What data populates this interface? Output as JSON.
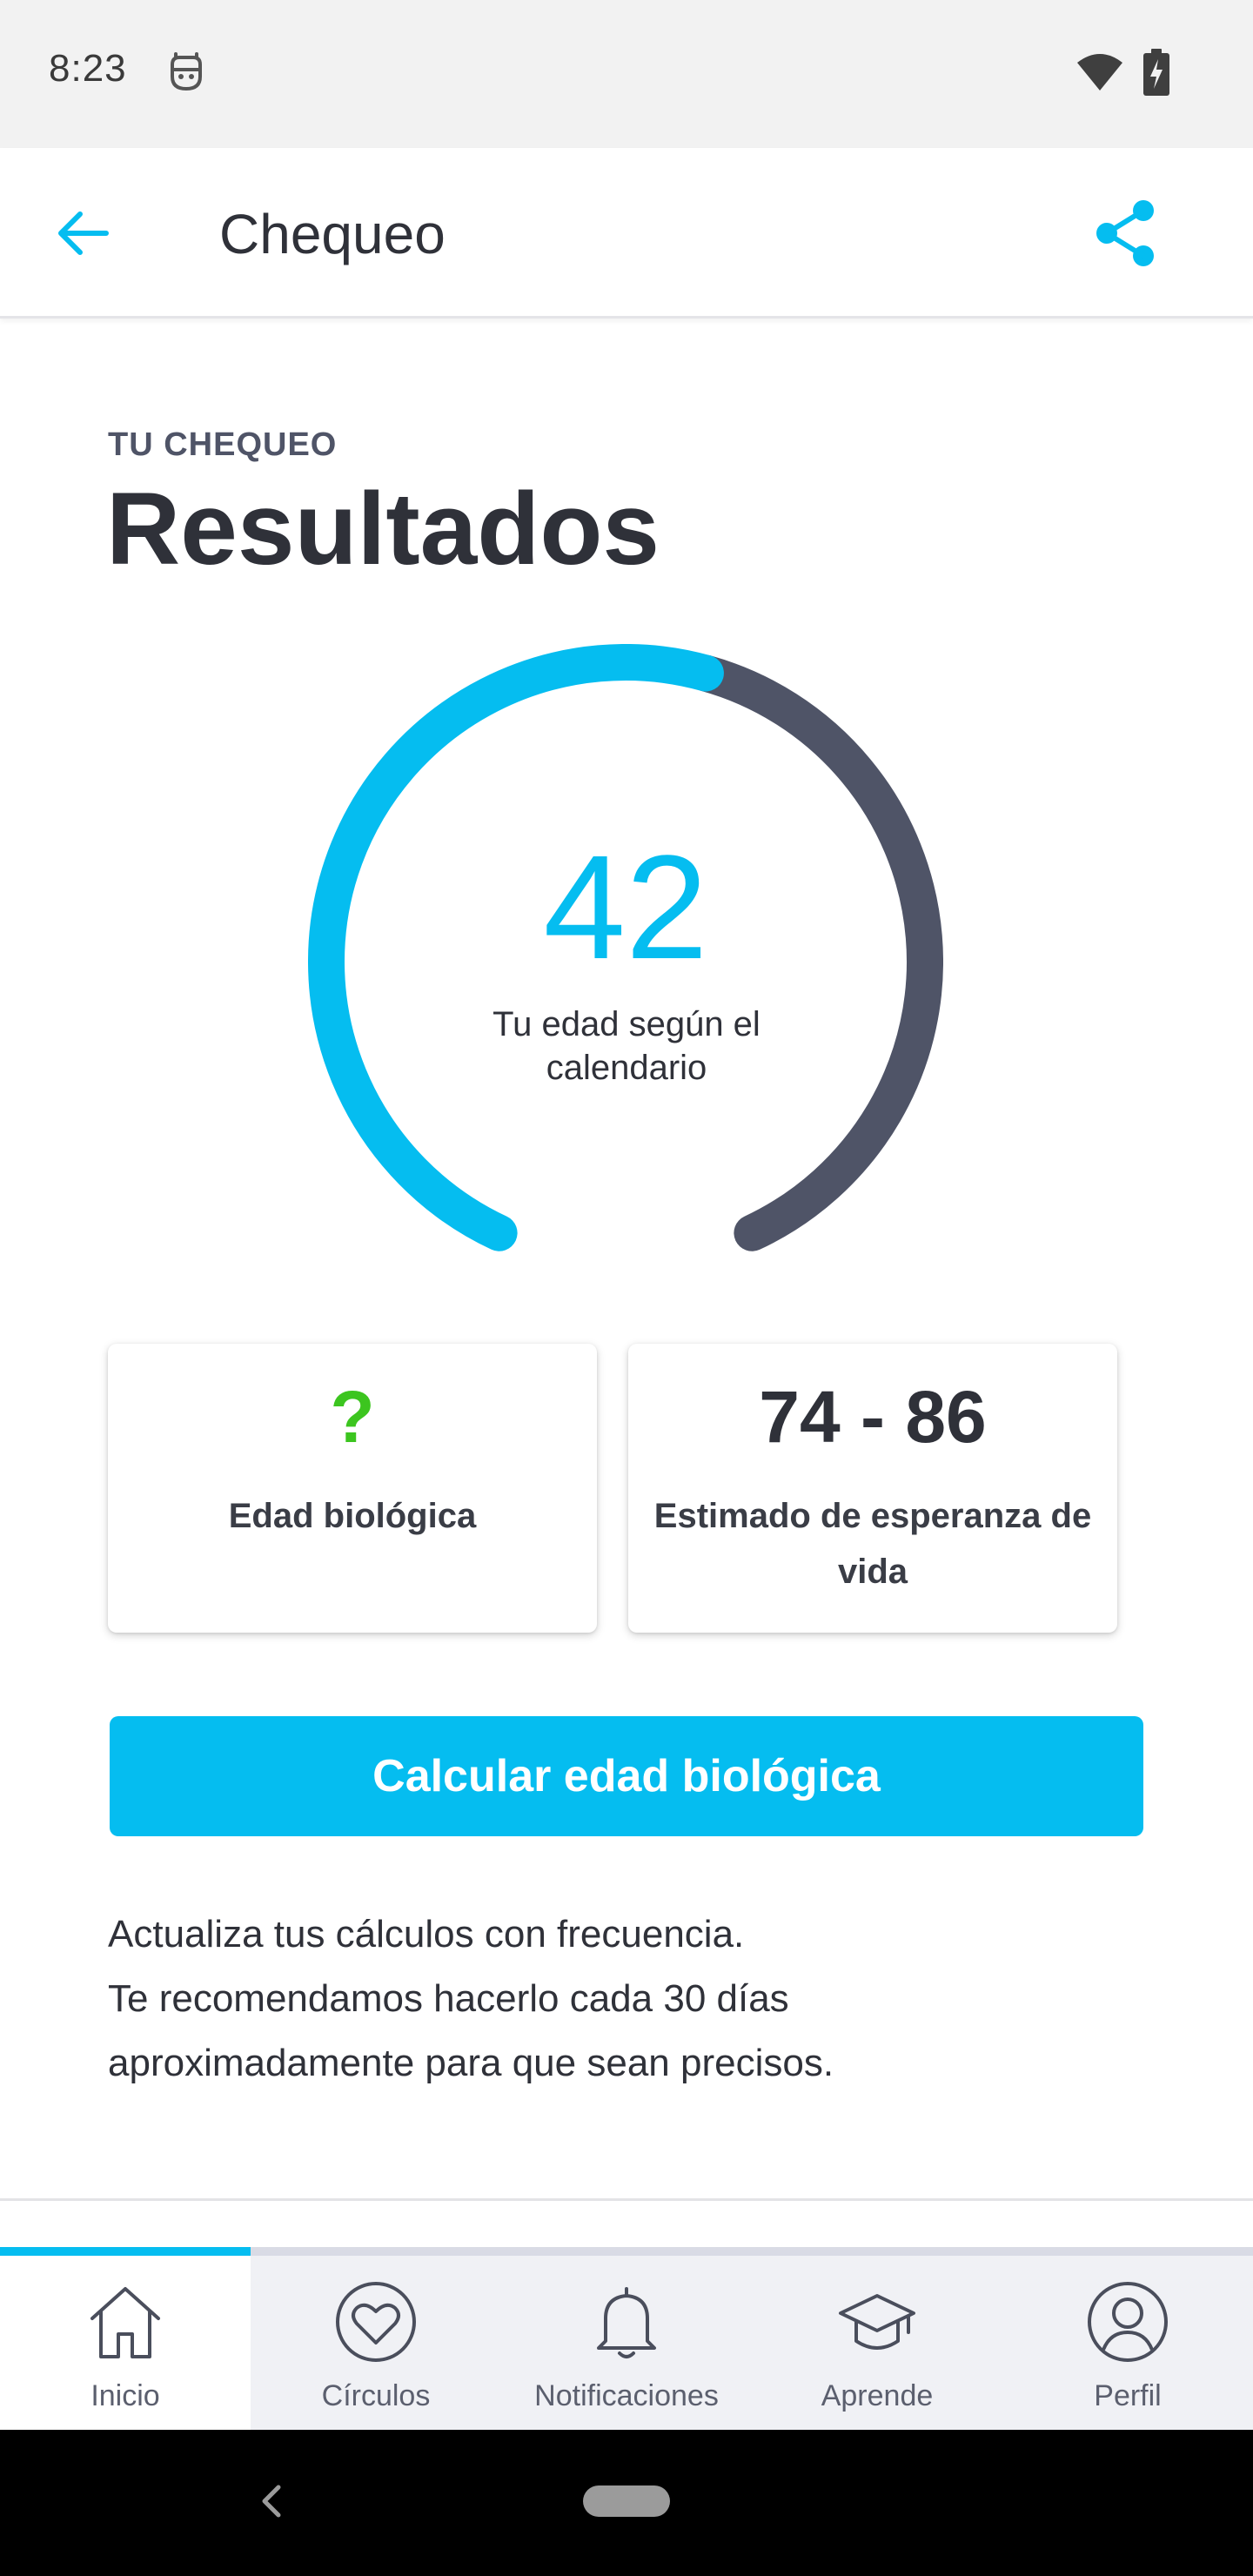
{
  "status_bar": {
    "time": "8:23",
    "icons": [
      "robot-icon",
      "wifi-icon",
      "battery-charging-icon"
    ]
  },
  "app_bar": {
    "title": "Chequeo",
    "back_icon": "arrow-left-icon",
    "share_icon": "share-icon",
    "accent_color": "#05bdf0"
  },
  "content": {
    "eyebrow": "TU CHEQUEO",
    "title": "Resultados",
    "gauge": {
      "value": "42",
      "label": "Tu edad según el calendario",
      "fill_fraction": 0.55,
      "fill_color": "#05bdf0",
      "track_color": "#4f5467"
    },
    "cards": [
      {
        "value": "?",
        "caption": "Edad biológica",
        "value_color": "#3cc51f"
      },
      {
        "value": "74 - 86",
        "caption": "Estimado de esperanza de vida"
      }
    ],
    "cta_label": "Calcular edad biológica",
    "note_lines": [
      "Actualiza tus cálculos con frecuencia.",
      "Te recomendamos hacerlo cada 30 días",
      "aproximadamente para que sean precisos."
    ]
  },
  "bottom_nav": {
    "active_index": 0,
    "items": [
      {
        "label": "Inicio",
        "icon": "home-icon"
      },
      {
        "label": "Círculos",
        "icon": "heart-circle-icon"
      },
      {
        "label": "Notificaciones",
        "icon": "bell-icon"
      },
      {
        "label": "Aprende",
        "icon": "graduation-cap-icon"
      },
      {
        "label": "Perfil",
        "icon": "user-icon"
      }
    ]
  },
  "system_nav": {
    "icons": [
      "back-chevron-icon",
      "home-pill-icon"
    ]
  }
}
